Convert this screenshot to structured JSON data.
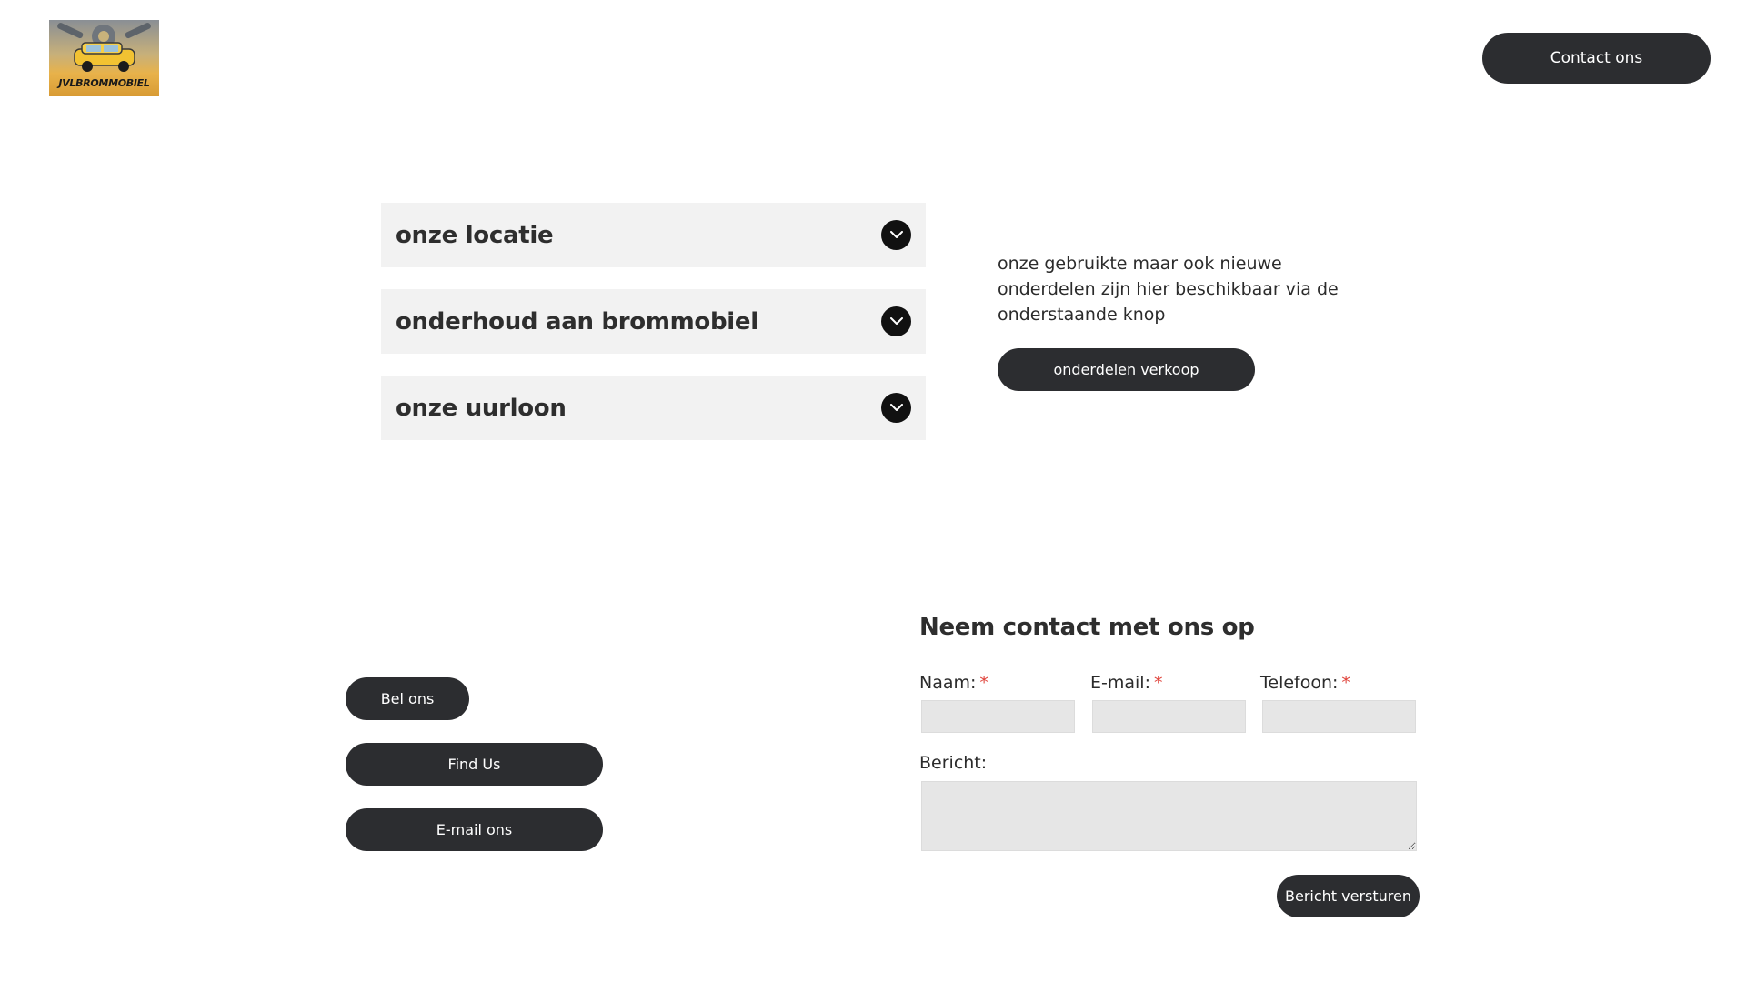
{
  "header": {
    "logo_text": "JVLBROMMOBIEL",
    "contact_button": "Contact ons"
  },
  "accordion": {
    "items": [
      {
        "title": "onze locatie",
        "icon": "chevron-down-icon"
      },
      {
        "title": "onderhoud aan brommobiel",
        "icon": "chevron-down-icon"
      },
      {
        "title": "onze uurloon",
        "icon": "chevron-down-icon"
      }
    ]
  },
  "parts": {
    "text": "onze gebruikte maar ook nieuwe onderdelen zijn hier beschikbaar via de onderstaande knop",
    "button": "onderdelen verkoop"
  },
  "contact_links": {
    "call": "Bel ons",
    "find": "Find Us",
    "email": "E-mail ons"
  },
  "form": {
    "title": "Neem contact met ons op",
    "name_label": "Naam:",
    "email_label": "E-mail:",
    "phone_label": "Telefoon:",
    "required_mark": "*",
    "message_label": "Bericht:",
    "name_value": "",
    "email_value": "",
    "phone_value": "",
    "message_value": "",
    "submit": "Bericht versturen"
  },
  "colors": {
    "button_bg": "#2c2d30",
    "accordion_bg": "#f2f2f2",
    "required": "#e0443c"
  }
}
